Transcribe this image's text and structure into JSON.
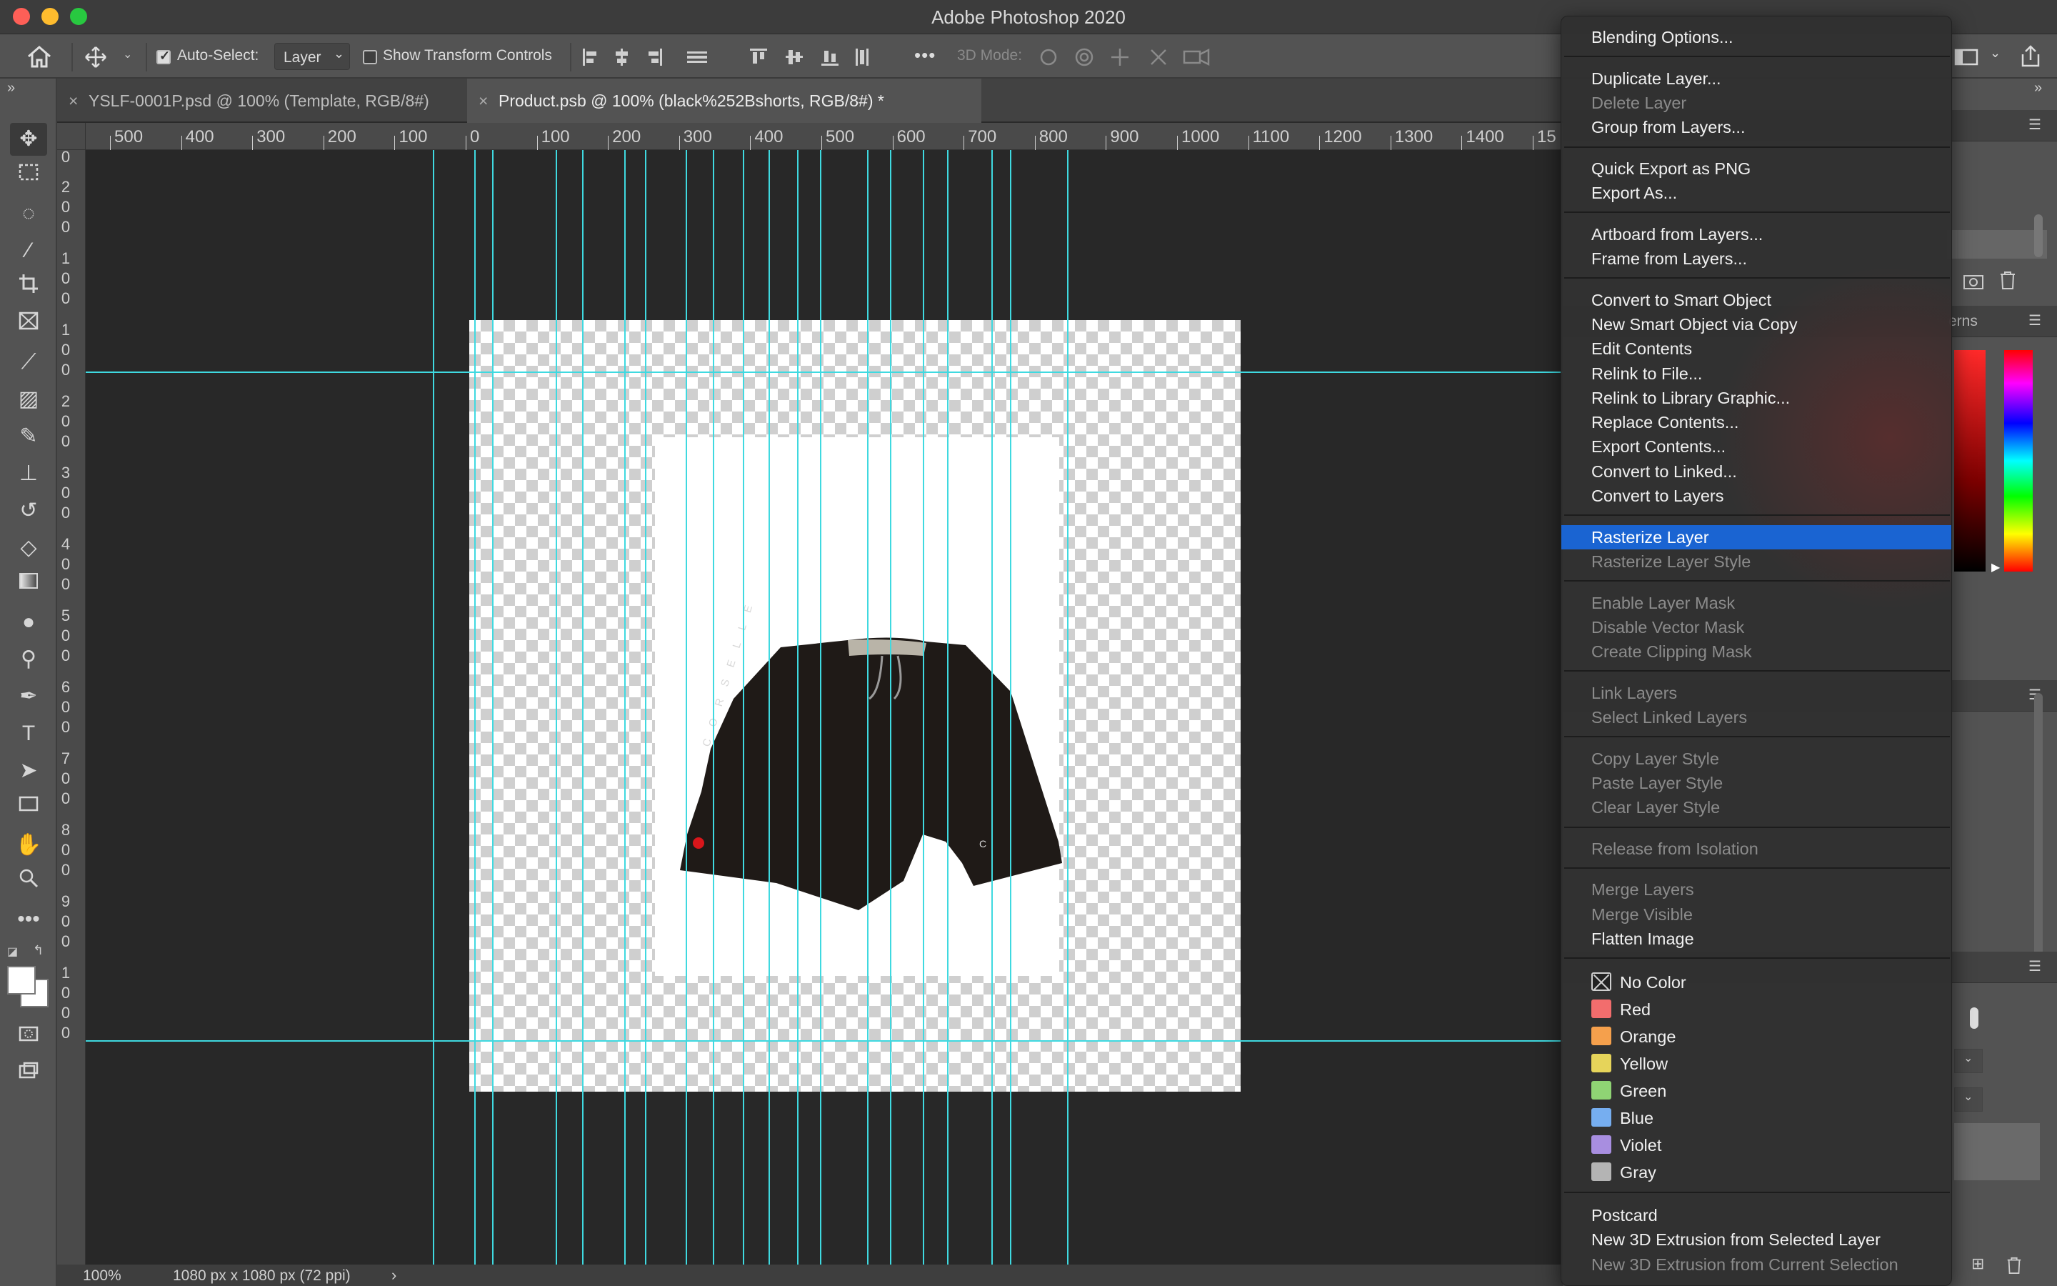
{
  "app": {
    "title": "Adobe Photoshop 2020"
  },
  "options_bar": {
    "auto_select_label": "Auto-Select:",
    "auto_select_checked": true,
    "auto_select_target": "Layer",
    "show_transform_label": "Show Transform Controls",
    "show_transform_checked": false,
    "mode_label": "3D Mode:",
    "more_label": "•••"
  },
  "tabs": [
    {
      "label": "YSLF-0001P.psd @ 100% (Template, RGB/8#)",
      "close": "×",
      "active": false
    },
    {
      "label": "Product.psb @ 100% (black%252Bshorts, RGB/8#) *",
      "close": "×",
      "active": true
    }
  ],
  "ruler": {
    "h_ticks": [
      "500",
      "400",
      "300",
      "200",
      "100",
      "0",
      "100",
      "200",
      "300",
      "400",
      "500",
      "600",
      "700",
      "800",
      "900",
      "1000",
      "1100",
      "1200",
      "1300",
      "1400",
      "15"
    ],
    "v_ticks": [
      [
        "0"
      ],
      [
        "2",
        "0",
        "0"
      ],
      [
        "1",
        "0",
        "0"
      ],
      [
        "1",
        "0",
        "0"
      ],
      [
        "2",
        "0",
        "0"
      ],
      [
        "3",
        "0",
        "0"
      ],
      [
        "4",
        "0",
        "0"
      ],
      [
        "5",
        "0",
        "0"
      ],
      [
        "6",
        "0",
        "0"
      ],
      [
        "7",
        "0",
        "0"
      ],
      [
        "8",
        "0",
        "0"
      ],
      [
        "9",
        "0",
        "0"
      ],
      [
        "1",
        "0",
        "0",
        "0"
      ]
    ]
  },
  "status_bar": {
    "zoom": "100%",
    "doc_size": "1080 px x 1080 px (72 ppi)",
    "arrow": "›"
  },
  "right_panel": {
    "tab_fragment": "erns"
  },
  "context_menu": {
    "groups": [
      [
        {
          "label": "Blending Options...",
          "enabled": true
        }
      ],
      [
        {
          "label": "Duplicate Layer...",
          "enabled": true
        },
        {
          "label": "Delete Layer",
          "enabled": false
        },
        {
          "label": "Group from Layers...",
          "enabled": true
        }
      ],
      [
        {
          "label": "Quick Export as PNG",
          "enabled": true
        },
        {
          "label": "Export As...",
          "enabled": true
        }
      ],
      [
        {
          "label": "Artboard from Layers...",
          "enabled": true
        },
        {
          "label": "Frame from Layers...",
          "enabled": true
        }
      ],
      [
        {
          "label": "Convert to Smart Object",
          "enabled": true
        },
        {
          "label": "New Smart Object via Copy",
          "enabled": true
        },
        {
          "label": "Edit Contents",
          "enabled": true
        },
        {
          "label": "Relink to File...",
          "enabled": true
        },
        {
          "label": "Relink to Library Graphic...",
          "enabled": true
        },
        {
          "label": "Replace Contents...",
          "enabled": true
        },
        {
          "label": "Export Contents...",
          "enabled": true
        },
        {
          "label": "Convert to Linked...",
          "enabled": true
        },
        {
          "label": "Convert to Layers",
          "enabled": true
        }
      ],
      [
        {
          "label": "Rasterize Layer",
          "enabled": true,
          "highlighted": true
        },
        {
          "label": "Rasterize Layer Style",
          "enabled": false
        }
      ],
      [
        {
          "label": "Enable Layer Mask",
          "enabled": false
        },
        {
          "label": "Disable Vector Mask",
          "enabled": false
        },
        {
          "label": "Create Clipping Mask",
          "enabled": false
        }
      ],
      [
        {
          "label": "Link Layers",
          "enabled": false
        },
        {
          "label": "Select Linked Layers",
          "enabled": false
        }
      ],
      [
        {
          "label": "Copy Layer Style",
          "enabled": false
        },
        {
          "label": "Paste Layer Style",
          "enabled": false
        },
        {
          "label": "Clear Layer Style",
          "enabled": false
        }
      ],
      [
        {
          "label": "Release from Isolation",
          "enabled": false
        }
      ],
      [
        {
          "label": "Merge Layers",
          "enabled": false
        },
        {
          "label": "Merge Visible",
          "enabled": false
        },
        {
          "label": "Flatten Image",
          "enabled": true
        }
      ]
    ],
    "colors": [
      {
        "label": "No Color",
        "swatch": "none"
      },
      {
        "label": "Red",
        "swatch": "#f26d6d"
      },
      {
        "label": "Orange",
        "swatch": "#f5a04c"
      },
      {
        "label": "Yellow",
        "swatch": "#e6d45a"
      },
      {
        "label": "Green",
        "swatch": "#8fd474"
      },
      {
        "label": "Blue",
        "swatch": "#76aef0"
      },
      {
        "label": "Violet",
        "swatch": "#a88ee0"
      },
      {
        "label": "Gray",
        "swatch": "#b4b4b4"
      }
    ],
    "tail": [
      {
        "label": "Postcard",
        "enabled": true
      },
      {
        "label": "New 3D Extrusion from Selected Layer",
        "enabled": true
      },
      {
        "label": "New 3D Extrusion from Current Selection",
        "enabled": false
      }
    ]
  },
  "canvas": {
    "layer_text": "C O R S E L L E",
    "logo_mark": "C"
  },
  "colors": {
    "guide": "#3fd9e0",
    "menu_highlight": "#1a64d2",
    "toolbar": "#535353",
    "canvas_bg": "#282828"
  }
}
